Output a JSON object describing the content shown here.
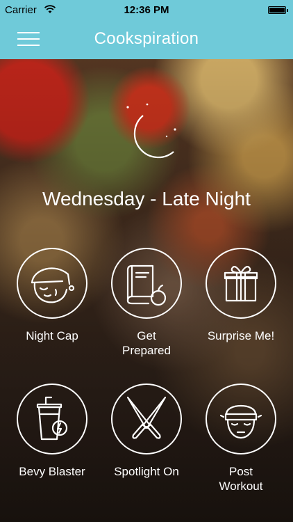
{
  "status_bar": {
    "carrier": "Carrier",
    "time": "12:36 PM",
    "battery_level": 1.0
  },
  "nav": {
    "title": "Cookspiration",
    "menu_icon": "hamburger-icon"
  },
  "header": {
    "icon": "moon-icon",
    "subtitle": "Wednesday - Late Night"
  },
  "tiles": [
    {
      "label": "Night Cap",
      "icon": "sleeping-face-icon"
    },
    {
      "label": "Get Prepared",
      "icon": "book-apple-icon"
    },
    {
      "label": "Surprise Me!",
      "icon": "gift-icon"
    },
    {
      "label": "Bevy Blaster",
      "icon": "energy-drink-icon"
    },
    {
      "label": "Spotlight On",
      "icon": "crossed-knives-icon"
    },
    {
      "label": "Post Workout",
      "icon": "headband-face-icon"
    }
  ],
  "colors": {
    "nav_bar": "#6fcad9",
    "text": "#ffffff"
  }
}
